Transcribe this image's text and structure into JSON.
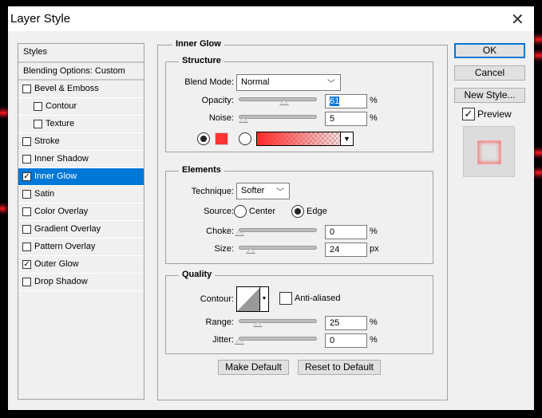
{
  "window": {
    "title": "Layer Style"
  },
  "styles_list": {
    "header": "Styles",
    "blending": "Blending Options: Custom",
    "items": [
      {
        "label": "Bevel & Emboss",
        "checked": false,
        "sub": false
      },
      {
        "label": "Contour",
        "checked": false,
        "sub": true
      },
      {
        "label": "Texture",
        "checked": false,
        "sub": true
      },
      {
        "label": "Stroke",
        "checked": false,
        "sub": false
      },
      {
        "label": "Inner Shadow",
        "checked": false,
        "sub": false
      },
      {
        "label": "Inner Glow",
        "checked": true,
        "sub": false,
        "selected": true
      },
      {
        "label": "Satin",
        "checked": false,
        "sub": false
      },
      {
        "label": "Color Overlay",
        "checked": false,
        "sub": false
      },
      {
        "label": "Gradient Overlay",
        "checked": false,
        "sub": false
      },
      {
        "label": "Pattern Overlay",
        "checked": false,
        "sub": false
      },
      {
        "label": "Outer Glow",
        "checked": true,
        "sub": false
      },
      {
        "label": "Drop Shadow",
        "checked": false,
        "sub": false
      }
    ]
  },
  "panel": {
    "title": "Inner Glow",
    "structure": {
      "title": "Structure",
      "blend_label": "Blend Mode:",
      "blend_value": "Normal",
      "opacity_label": "Opacity:",
      "opacity": "61",
      "opacity_unit": "%",
      "noise_label": "Noise:",
      "noise": "5",
      "noise_unit": "%",
      "color": "#ff3333",
      "color_mode": "solid"
    },
    "elements": {
      "title": "Elements",
      "technique_label": "Technique:",
      "technique_value": "Softer",
      "source_label": "Source:",
      "source_center": "Center",
      "source_edge": "Edge",
      "source_selected": "Edge",
      "choke_label": "Choke:",
      "choke": "0",
      "choke_unit": "%",
      "size_label": "Size:",
      "size": "24",
      "size_unit": "px"
    },
    "quality": {
      "title": "Quality",
      "contour_label": "Contour:",
      "anti_aliased": "Anti-aliased",
      "anti_aliased_checked": false,
      "range_label": "Range:",
      "range": "25",
      "range_unit": "%",
      "jitter_label": "Jitter:",
      "jitter": "0",
      "jitter_unit": "%"
    },
    "make_default": "Make Default",
    "reset_default": "Reset to Default"
  },
  "actions": {
    "ok": "OK",
    "cancel": "Cancel",
    "new_style": "New Style...",
    "preview": "Preview",
    "preview_checked": true
  },
  "colors": {
    "accent": "#0078d7",
    "glow": "#ff3333"
  }
}
